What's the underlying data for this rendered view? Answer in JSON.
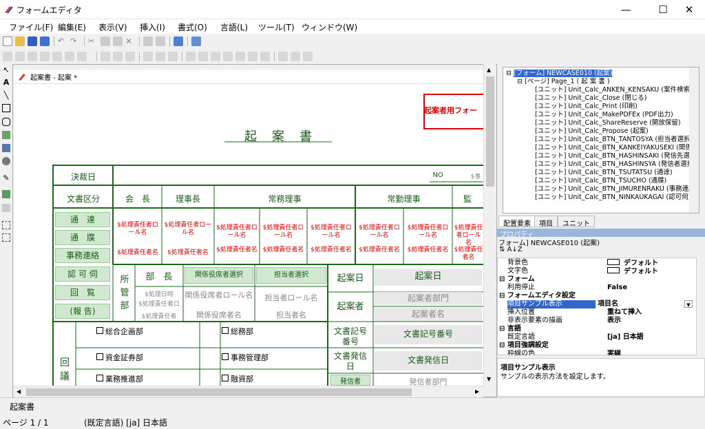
{
  "window": {
    "title": "フォームエディタ",
    "minimize": "—",
    "maximize": "☐",
    "close": "✕"
  },
  "menu": [
    "ファイル(F)",
    "編集(E)",
    "表示(V)",
    "挿入(I)",
    "書式(O)",
    "言語(L)",
    "ツール(T)",
    "ウィンドウ(W)"
  ],
  "document": {
    "tab_title": "起案書 - 起案 *",
    "red_label": "起案者用フォー",
    "form_title": "起　案　書",
    "no_label": "NO",
    "no_value": "$事",
    "rows": {
      "kessai": "決裁日",
      "bunsho": "文書区分",
      "headers": [
        "会　長",
        "理事長",
        "常務理事",
        "常勤理事",
        "監"
      ],
      "kubun": [
        "通　達",
        "通　牒",
        "事務連絡",
        "認 可 伺",
        "回　覧",
        "(報 告)"
      ],
      "red_a": "$処理責任者ロール名",
      "red_b": "$処理責任者名",
      "shokan": "所管部",
      "bucho": "部　長",
      "kankei_btn": "関係役席者選択",
      "tanto_btn": "担当者選択",
      "kianbi": "起案日",
      "kianbi_val": "起案日",
      "kiansha": "起案者",
      "kiansha_bumon": "起案者部門",
      "kiansha_mei": "起案者名",
      "bu_a": "$処理日時",
      "bu_b": "$処理責任者ロ",
      "bu_c": "$処理責任者",
      "kankei_role": "関係役席者ロール名",
      "kankei_name": "関係役席者名",
      "tanto_role": "担当者ロール名",
      "tanto_name": "担当者名",
      "bunsho_kigo": "文書記号番号",
      "bunsho_kigo_val": "文書記号番号",
      "bunsho_hasshin": "文書発信日",
      "bunsho_hasshin_val": "文書発信日",
      "kaigi": "回議",
      "checks_left": [
        "総合企画部",
        "資金証券部",
        "業務推進部"
      ],
      "checks_right": [
        "総務部",
        "事務管理部",
        "融資部"
      ],
      "hasshin_btn": "発信者",
      "hasshin_bumon": "発信者部門"
    }
  },
  "tree": [
    "[フォーム] NEWCASE010 (起案)",
    "[ページ] Page_1 ( 起 案 書 )",
    "[ユニット] Unit_Calc_ANKEN_KENSAKU (案件検索)",
    "[ユニット] Unit_Calc_Close (閉じる)",
    "[ユニット] Unit_Calc_Print (印刷)",
    "[ユニット] Unit_Calc_MakePDFEx (PDF出力)",
    "[ユニット] Unit_Calc_ShareReserve (開放保留)",
    "[ユニット] Unit_Calc_Propose (起案)",
    "[ユニット] Unit_Calc_BTN_TANTOSYA (担当者選択",
    "[ユニット] Unit_Calc_BTN_KANKEIYAKUSEKI (関係役",
    "[ユニット] Unit_Calc_BTN_HASHINSAKI (発信先選択",
    "[ユニット] Unit_Calc_BTN_HASHINSYA (発信者選択",
    "[ユニット] Unit_Calc_BTN_TSUTATSU (通達)",
    "[ユニット] Unit_Calc_BTN_TSUCHO (通牒)",
    "[ユニット] Unit_Calc_BTN_JIMURENRAKU (事務連絡",
    "[ユニット] Unit_Calc_BTN_NINKAUKAGAI (認可伺)"
  ],
  "tabs": [
    "配置要素",
    "項目",
    "ユニット"
  ],
  "props": {
    "header": "プロパティ",
    "object": "フォーム] NEWCASE010 (起案)",
    "rows": [
      {
        "k": "背景色",
        "v": "デフォルト",
        "swatch": true
      },
      {
        "k": "文字色",
        "v": "デフォルト",
        "swatch": true
      },
      {
        "k": "フォーム",
        "v": "",
        "cat": true
      },
      {
        "k": "利用停止",
        "v": "False"
      },
      {
        "k": "フォームエディタ設定",
        "v": "",
        "cat": true
      },
      {
        "k": "項目サンプル表示",
        "v": "項目名",
        "sel": true
      },
      {
        "k": "挿入位置",
        "v": "重ねて挿入"
      },
      {
        "k": "非表示要素の描画",
        "v": "表示"
      },
      {
        "k": "言語",
        "v": "",
        "cat": true
      },
      {
        "k": "既定言語",
        "v": "[ja] 日本語"
      },
      {
        "k": "項目強調設定",
        "v": "",
        "cat": true
      },
      {
        "k": "枠線の色",
        "v": "実線"
      }
    ],
    "desc_title": "項目サンプル表示",
    "desc_text": "サンプルの表示方法を設定します。"
  },
  "status": {
    "line1": "起案書",
    "page": "ページ 1 / 1",
    "lang": "(既定言語) [ja] 日本語"
  }
}
